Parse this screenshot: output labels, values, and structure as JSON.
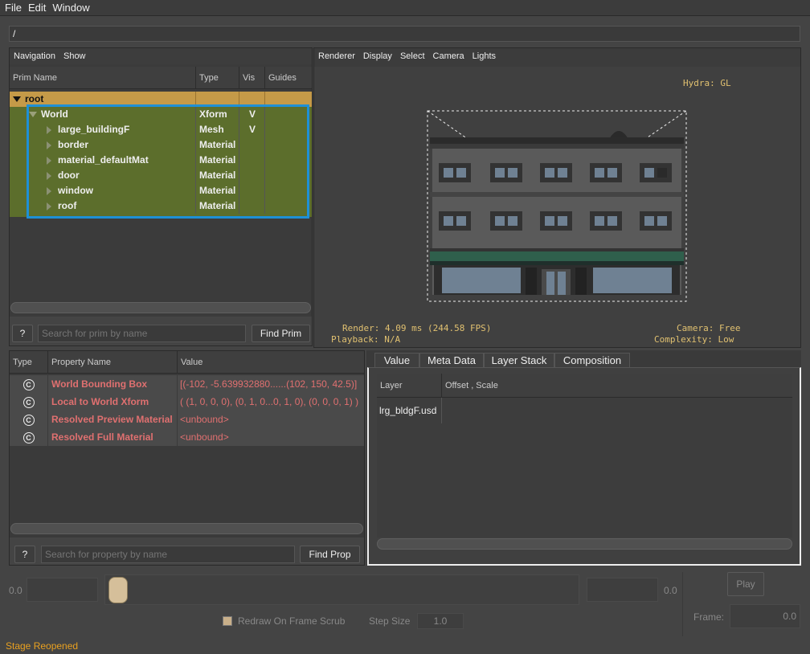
{
  "menubar": {
    "items": [
      "File",
      "Edit",
      "Window"
    ]
  },
  "path": "/",
  "prim_browser": {
    "menu": [
      "Navigation",
      "Show"
    ],
    "columns": [
      "Prim Name",
      "Type",
      "Vis",
      "Guides"
    ],
    "rows": [
      {
        "name": "root",
        "type": "",
        "vis": ""
      },
      {
        "name": "World",
        "type": "Xform",
        "vis": "V"
      },
      {
        "name": "large_buildingF",
        "type": "Mesh",
        "vis": "V"
      },
      {
        "name": "border",
        "type": "Material",
        "vis": ""
      },
      {
        "name": "material_defaultMat",
        "type": "Material",
        "vis": ""
      },
      {
        "name": "door",
        "type": "Material",
        "vis": ""
      },
      {
        "name": "window",
        "type": "Material",
        "vis": ""
      },
      {
        "name": "roof",
        "type": "Material",
        "vis": ""
      }
    ],
    "help_label": "?",
    "search_placeholder": "Search for prim by name",
    "find_label": "Find Prim"
  },
  "viewport": {
    "menu": [
      "Renderer",
      "Display",
      "Select",
      "Camera",
      "Lights"
    ],
    "hydra": "Hydra: GL",
    "render": "Render: 4.09 ms (244.58 FPS)",
    "playback": "Playback: N/A",
    "camera": "Camera: Free",
    "complexity": "Complexity: Low"
  },
  "properties": {
    "columns": [
      "Type",
      "Property Name",
      "Value"
    ],
    "rows": [
      {
        "icon": "C",
        "name": "World Bounding Box",
        "value": "[(-102, -5.639932880......(102, 150, 42.5)]"
      },
      {
        "icon": "C",
        "name": "Local to World Xform",
        "value": "( (1, 0, 0, 0), (0, 1, 0...0, 1, 0), (0, 0, 0, 1) )"
      },
      {
        "icon": "C",
        "name": "Resolved Preview Material",
        "value": "<unbound>"
      },
      {
        "icon": "C",
        "name": "Resolved Full Material",
        "value": "<unbound>"
      }
    ],
    "help_label": "?",
    "search_placeholder": "Search for property by name",
    "find_label": "Find Prop"
  },
  "layer_panel": {
    "tabs": [
      "Value",
      "Meta Data",
      "Layer Stack",
      "Composition"
    ],
    "columns": [
      "Layer",
      "Offset , Scale"
    ],
    "rows": [
      {
        "layer": "lrg_bldgF.usd",
        "offset": ""
      }
    ]
  },
  "timeline": {
    "start": "0.0",
    "end": "0.0",
    "play_label": "Play",
    "redraw_label": "Redraw On Frame Scrub",
    "step_label": "Step Size",
    "step_value": "1.0",
    "frame_label": "Frame:",
    "frame_value": "0.0"
  },
  "status": "Stage Reopened"
}
